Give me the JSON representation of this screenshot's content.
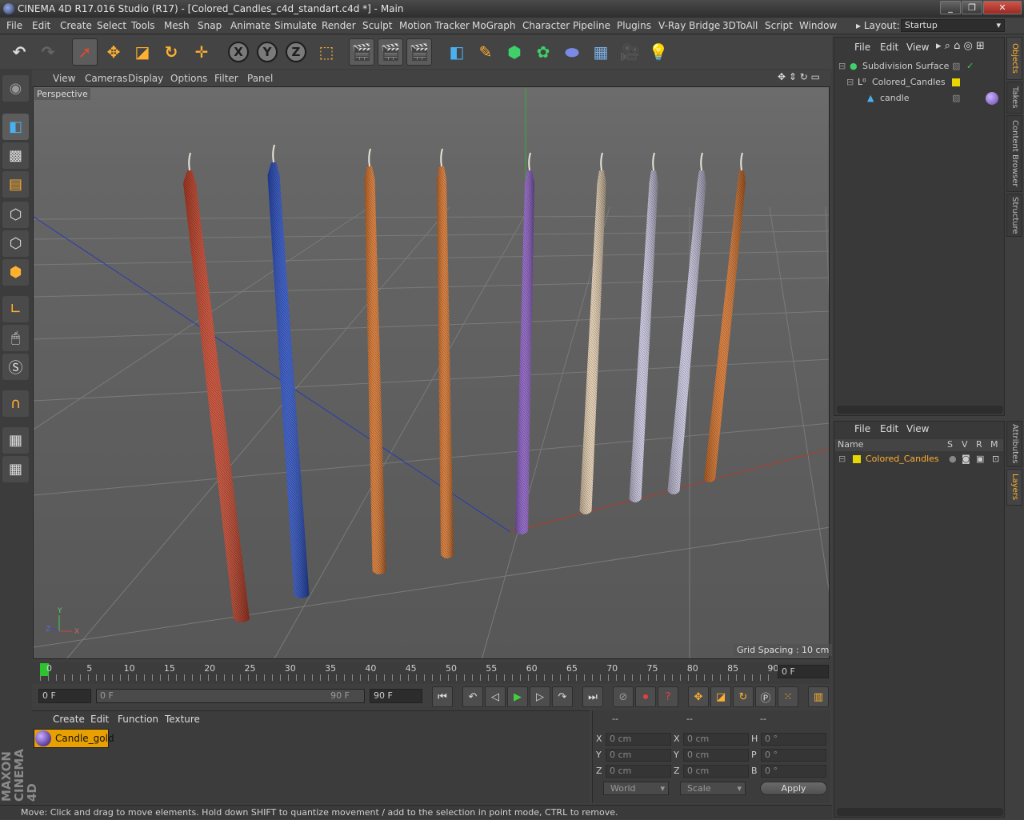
{
  "window": {
    "title": "CINEMA 4D R17.016 Studio (R17) - [Colored_Candles_c4d_standart.c4d *] - Main"
  },
  "menubar": {
    "items": [
      "File",
      "Edit",
      "Create",
      "Select",
      "Tools",
      "Mesh",
      "Snap",
      "Animate",
      "Simulate",
      "Render",
      "Sculpt",
      "Motion Tracker",
      "MoGraph",
      "Character",
      "Pipeline",
      "Plugins",
      "V-Ray Bridge",
      "3DToAll",
      "Script",
      "Window"
    ],
    "layout_label": "Layout:",
    "layout_value": "Startup"
  },
  "toolbar": {
    "axis_x": "X",
    "axis_y": "Y",
    "axis_z": "Z"
  },
  "viewport": {
    "menu": [
      "View",
      "Cameras",
      "Display",
      "Options",
      "Filter",
      "Panel"
    ],
    "label": "Perspective",
    "grid_spacing": "Grid Spacing : 10 cm",
    "axis_labels": {
      "y": "Y",
      "z": "Z",
      "x": "X"
    },
    "candle_colors": [
      "#c8442a",
      "#2a4fc4",
      "#d9732a",
      "#d9732a",
      "#8a5cc4",
      "#e6cfb0",
      "#c9c6e0",
      "#c9c6e0",
      "#d9732a"
    ]
  },
  "timeline": {
    "ticks": [
      "0",
      "5",
      "10",
      "15",
      "20",
      "25",
      "30",
      "35",
      "40",
      "45",
      "50",
      "55",
      "60",
      "65",
      "70",
      "75",
      "80",
      "85",
      "90"
    ],
    "current_frame": "0 F"
  },
  "transport": {
    "start_field": "0 F",
    "range_start": "0 F",
    "range_end": "90 F",
    "end_field": "90 F"
  },
  "material_manager": {
    "menu": [
      "Create",
      "Edit",
      "Function",
      "Texture"
    ],
    "materials": [
      {
        "name": "Candle_gold"
      }
    ],
    "brand": "MAXON CINEMA 4D"
  },
  "coordinates": {
    "headers": [
      "--",
      "--",
      "--"
    ],
    "rows": [
      {
        "l1": "X",
        "v1": "0 cm",
        "l2": "X",
        "v2": "0 cm",
        "l3": "H",
        "v3": "0 °"
      },
      {
        "l1": "Y",
        "v1": "0 cm",
        "l2": "Y",
        "v2": "0 cm",
        "l3": "P",
        "v3": "0 °"
      },
      {
        "l1": "Z",
        "v1": "0 cm",
        "l2": "Z",
        "v2": "0 cm",
        "l3": "B",
        "v3": "0 °"
      }
    ],
    "space_dropdown": "World",
    "mode_dropdown": "Scale",
    "apply_label": "Apply"
  },
  "status": {
    "text": "Move: Click and drag to move elements. Hold down SHIFT to quantize movement / add to the selection in point mode, CTRL to remove."
  },
  "object_manager": {
    "menu": [
      "File",
      "Edit",
      "View"
    ],
    "objects": [
      {
        "name": "Subdivision Surface",
        "depth": 0
      },
      {
        "name": "Colored_Candles",
        "depth": 1
      },
      {
        "name": "candle",
        "depth": 2
      }
    ]
  },
  "layer_manager": {
    "menu": [
      "File",
      "Edit",
      "View"
    ],
    "columns": [
      "Name",
      "S",
      "V",
      "R",
      "M"
    ],
    "layers": [
      {
        "name": "Colored_Candles",
        "color": "#e8d800"
      }
    ]
  },
  "side_tabs": {
    "top": [
      "Objects",
      "Takes",
      "Content Browser",
      "Structure"
    ],
    "bottom": [
      "Attributes",
      "Layers"
    ]
  }
}
